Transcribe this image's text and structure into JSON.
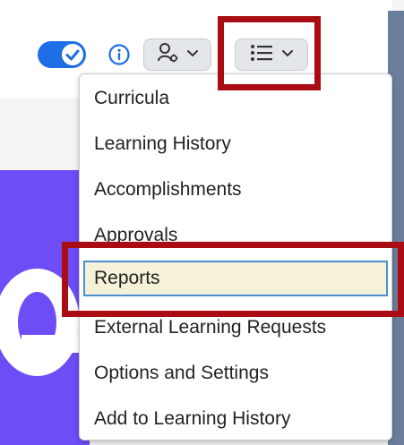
{
  "toolbar": {
    "toggle_on": true,
    "icons": {
      "info": "info-icon",
      "people": "people-settings-icon",
      "list": "list-icon",
      "chevron": "chevron-down-icon"
    }
  },
  "menu": {
    "items": [
      {
        "label": "Curricula"
      },
      {
        "label": "Learning History"
      },
      {
        "label": "Accomplishments"
      },
      {
        "label": "Approvals"
      },
      {
        "label": "Reports",
        "selected": true
      },
      {
        "label": "External Learning Requests"
      },
      {
        "label": "Options and Settings"
      },
      {
        "label": "Add to Learning History"
      }
    ]
  },
  "colors": {
    "accent": "#1f6ee5",
    "highlight": "#a90d13",
    "selection_bg": "#f6f1d9",
    "selection_border": "#4b8fcf",
    "banner": "#6e4df7"
  }
}
